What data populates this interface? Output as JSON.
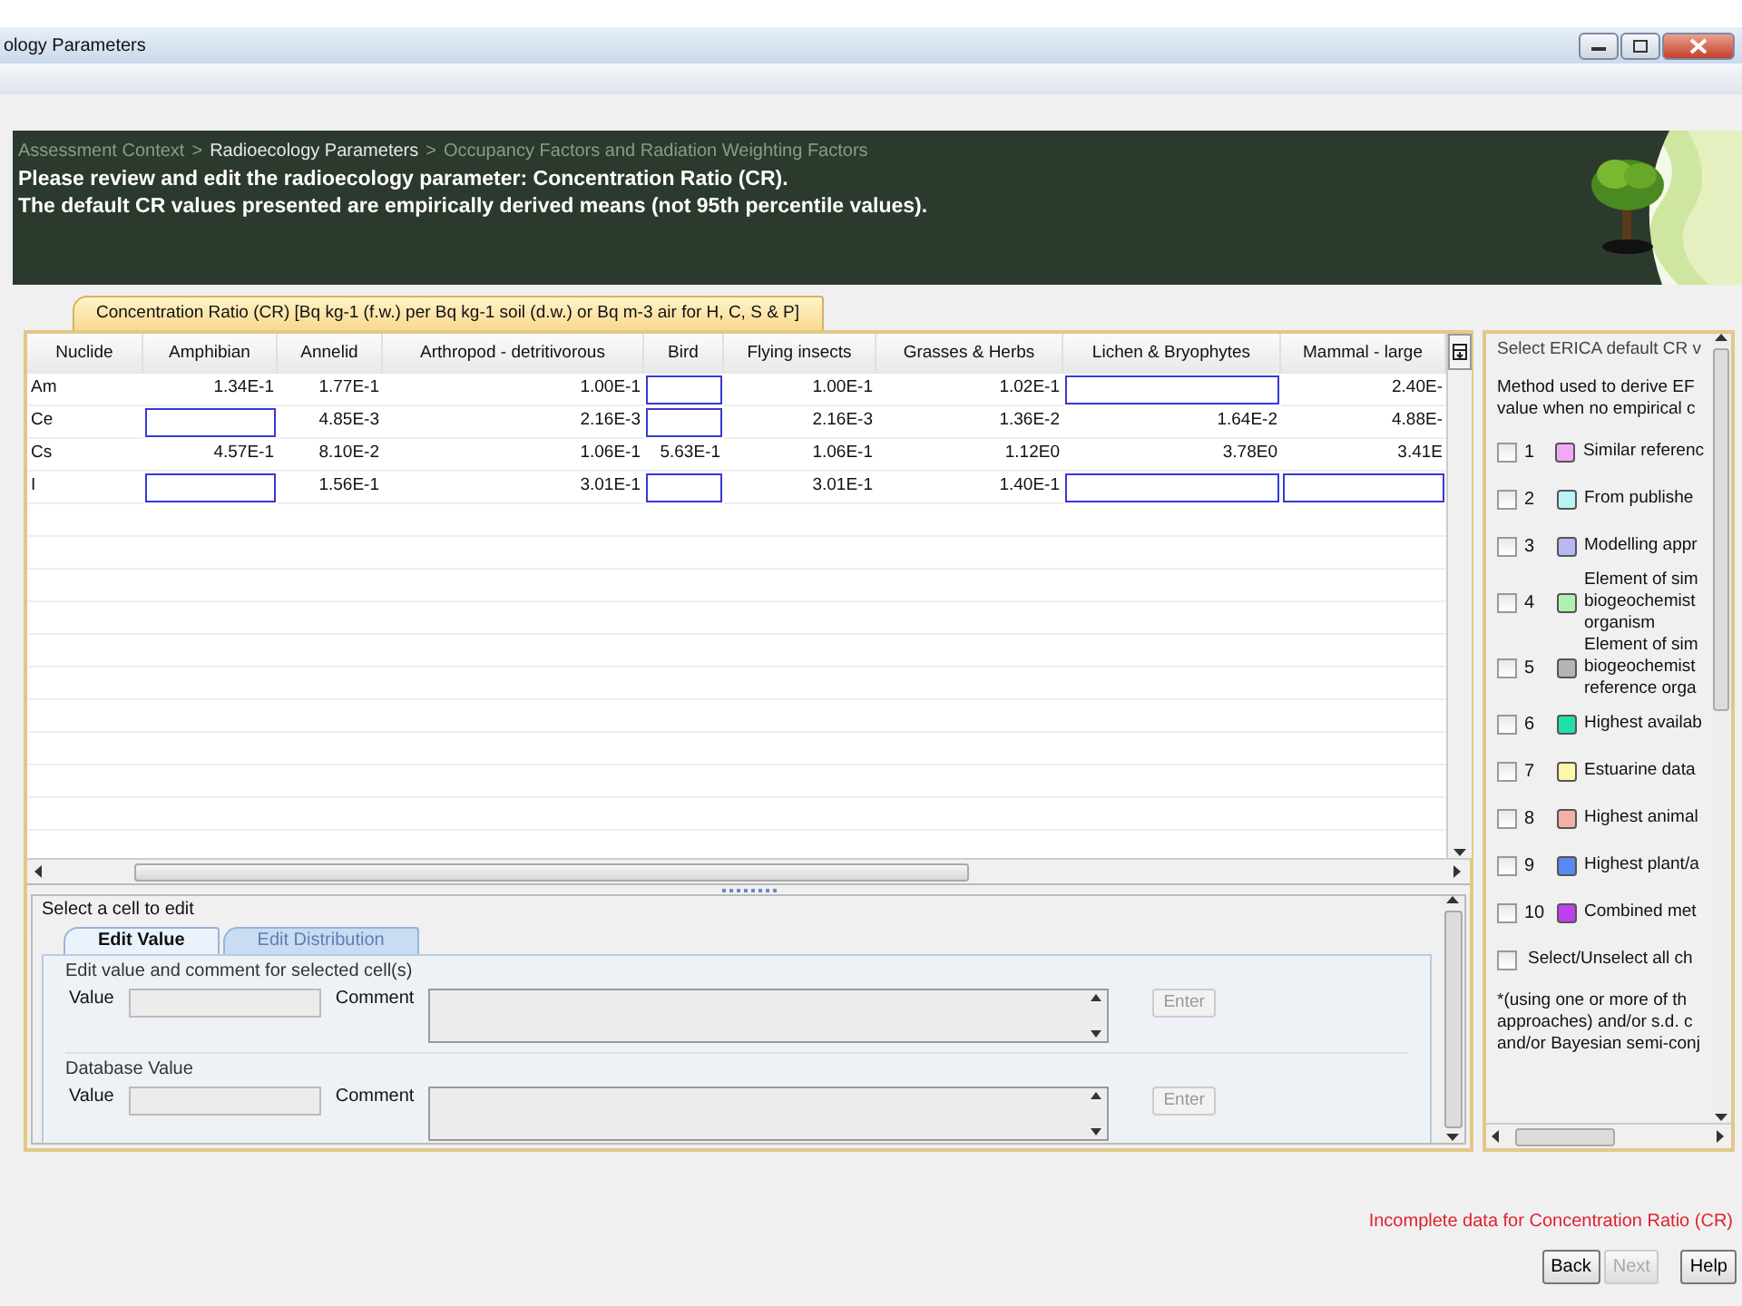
{
  "window": {
    "title": "ology Parameters"
  },
  "breadcrumb": [
    {
      "kind": "step",
      "label": "Assessment Context",
      "current": false
    },
    {
      "kind": "sep",
      "label": ">"
    },
    {
      "kind": "step",
      "label": "Radioecology Parameters",
      "current": true
    },
    {
      "kind": "sep",
      "label": ">"
    },
    {
      "kind": "step",
      "label": "Occupancy Factors and Radiation Weighting Factors",
      "current": false
    }
  ],
  "header_lines": [
    "Please review and edit the radioecology parameter: Concentration Ratio (CR).",
    "The default CR values presented are empirically derived means (not 95th percentile values)."
  ],
  "param_tab": {
    "label": "Concentration Ratio (CR) [Bq kg-1 (f.w.) per Bq kg-1 soil (d.w.) or Bq m-3 air for H, C, S & P]",
    "selected": true
  },
  "table": {
    "columns": [
      "Nuclide",
      "Amphibian",
      "Annelid",
      "Arthropod - detritivorous",
      "Bird",
      "Flying insects",
      "Grasses & Herbs",
      "Lichen & Bryophytes",
      "Mammal - large"
    ],
    "rows": [
      {
        "cells": [
          "Am",
          "1.34E-1",
          "1.77E-1",
          "1.00E-1",
          null,
          "1.00E-1",
          "1.02E-1",
          null,
          "2.40E-"
        ]
      },
      {
        "cells": [
          "Ce",
          null,
          "4.85E-3",
          "2.16E-3",
          null,
          "2.16E-3",
          "1.36E-2",
          "1.64E-2",
          "4.88E-"
        ]
      },
      {
        "cells": [
          "Cs",
          "4.57E-1",
          "8.10E-2",
          "1.06E-1",
          "5.63E-1",
          "1.06E-1",
          "1.12E0",
          "3.78E0",
          "3.41E"
        ]
      },
      {
        "cells": [
          "I",
          null,
          "1.56E-1",
          "3.01E-1",
          null,
          "3.01E-1",
          "1.40E-1",
          null,
          null
        ]
      }
    ]
  },
  "right_panel": {
    "title": "Select ERICA default CR v",
    "intro": "Method used to derive EF\nvalue when no empirical c",
    "methods": [
      {
        "number": "1",
        "label": "Similar referenc",
        "color": "#f4a8f4",
        "checked": false
      },
      {
        "number": "2",
        "label": "From publishe",
        "color": "#b8f4f4",
        "checked": false
      },
      {
        "number": "3",
        "label": "Modelling appr",
        "color": "#b8b8f0",
        "checked": false
      },
      {
        "number": "4",
        "label": "Element of sim\nbiogeochemist\norganism",
        "color": "#b0f0b0",
        "checked": false
      },
      {
        "number": "5",
        "label": "Element of sim\nbiogeochemist\nreference orga",
        "color": "#b4b4b4",
        "checked": false
      },
      {
        "number": "6",
        "label": "Highest availab",
        "color": "#20e0a8",
        "checked": false
      },
      {
        "number": "7",
        "label": "Estuarine data",
        "color": "#fff8a8",
        "checked": false
      },
      {
        "number": "8",
        "label": "Highest animal",
        "color": "#f4b0a8",
        "checked": false
      },
      {
        "number": "9",
        "label": "Highest plant/a",
        "color": "#5888f0",
        "checked": false
      },
      {
        "number": "10",
        "label": "Combined met",
        "color": "#c040f0",
        "checked": false
      }
    ],
    "select_all": {
      "label": "Select/Unselect all ch",
      "checked": false
    },
    "footnote": "*(using one or more of th\napproaches) and/or s.d. c\nand/or Bayesian semi-conj"
  },
  "edit_panel": {
    "prompt": "Select a cell to edit",
    "tabs": [
      {
        "label": "Edit Value",
        "selected": true,
        "disabled": false
      },
      {
        "label": "Edit Distribution",
        "selected": false,
        "disabled": true
      }
    ],
    "groups": [
      {
        "title": "Edit value and comment for selected cell(s)",
        "value_label": "Value",
        "comment_label": "Comment",
        "button": {
          "label": "Enter",
          "disabled": true
        }
      },
      {
        "title": "Database Value",
        "value_label": "Value",
        "comment_label": "Comment",
        "button": {
          "label": "Enter",
          "disabled": true
        }
      }
    ]
  },
  "status": {
    "message": "Incomplete data for Concentration Ratio (CR)"
  },
  "buttons": [
    {
      "label": "Back",
      "disabled": false
    },
    {
      "label": "Next",
      "disabled": true
    },
    {
      "label": "Help",
      "disabled": false
    }
  ]
}
